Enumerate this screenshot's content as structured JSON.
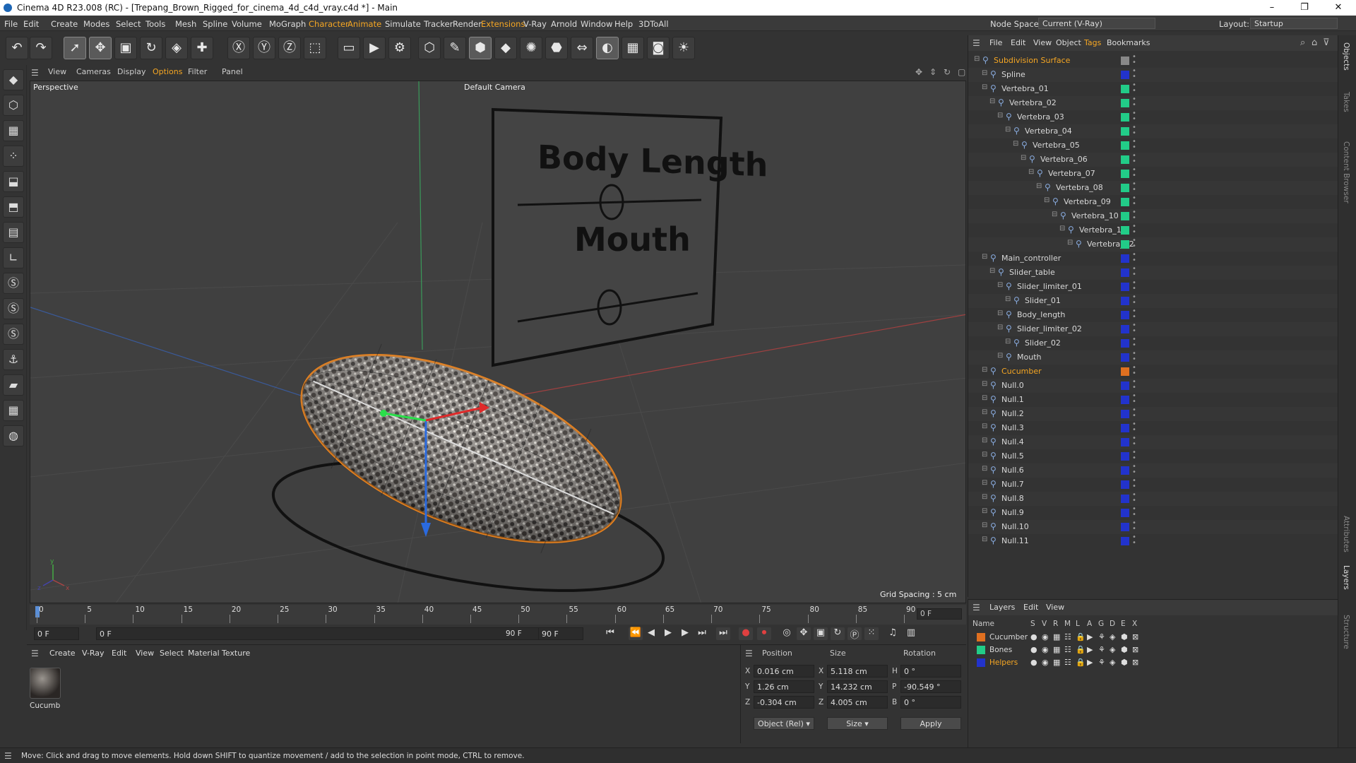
{
  "titlebar": {
    "title": "Cinema 4D R23.008 (RC) - [Trepang_Brown_Rigged_for_cinema_4d_c4d_vray.c4d *] - Main",
    "minimize": "–",
    "maximize": "❐",
    "close": "✕"
  },
  "menu": [
    "File",
    "Edit",
    "Create",
    "Modes",
    "Select",
    "Tools",
    "Mesh",
    "Spline",
    "Volume",
    "MoGraph",
    "Character",
    "Animate",
    "Simulate",
    "Tracker",
    "Render",
    "Extensions",
    "V-Ray",
    "Arnold",
    "Window",
    "Help",
    "3DToAll"
  ],
  "nodespace": {
    "label": "Node Space:",
    "value": "Current (V-Ray)"
  },
  "layout": {
    "label": "Layout:",
    "value": "Startup"
  },
  "viewport": {
    "menu": [
      "View",
      "Cameras",
      "Display",
      "Options",
      "Filter",
      "Panel"
    ],
    "name": "Perspective",
    "camera": "Default Camera",
    "grid_spacing": "Grid Spacing : 5 cm",
    "sign_text_1": "Body Length",
    "sign_text_2": "Mouth"
  },
  "timeline": {
    "ticks": [
      "0",
      "5",
      "10",
      "15",
      "20",
      "25",
      "30",
      "35",
      "40",
      "45",
      "50",
      "55",
      "60",
      "65",
      "70",
      "75",
      "80",
      "85",
      "90"
    ],
    "current": "0 F"
  },
  "transport": {
    "start": "0 F",
    "field2": "0 F",
    "end": "90 F",
    "end2": "90 F"
  },
  "material": {
    "menu": [
      "Create",
      "V-Ray",
      "Edit",
      "View",
      "Select",
      "Material",
      "Texture"
    ],
    "name": "Cucumb"
  },
  "coords": {
    "headers": [
      "Position",
      "Size",
      "Rotation"
    ],
    "x": {
      "axis": "X",
      "pos": "0.016 cm",
      "size_axis": "X",
      "size": "5.118 cm",
      "rot_axis": "H",
      "rot": "0 °"
    },
    "y": {
      "axis": "Y",
      "pos": "1.26 cm",
      "size_axis": "Y",
      "size": "14.232 cm",
      "rot_axis": "P",
      "rot": "-90.549 °"
    },
    "z": {
      "axis": "Z",
      "pos": "-0.304 cm",
      "size_axis": "Z",
      "size": "4.005 cm",
      "rot_axis": "B",
      "rot": "0 °"
    },
    "mode": "Object (Rel)",
    "size_mode": "Size",
    "apply": "Apply"
  },
  "objects": {
    "menu": [
      "File",
      "Edit",
      "View",
      "Object",
      "Tags",
      "Bookmarks"
    ],
    "items": [
      {
        "name": "Subdivision Surface",
        "indent": 0,
        "color": "#f5a623",
        "swatch": "#888"
      },
      {
        "name": "Spline",
        "indent": 1,
        "color": "#d8d8d8",
        "swatch": "#2233cc"
      },
      {
        "name": "Vertebra_01",
        "indent": 1,
        "color": "#d8d8d8",
        "swatch": "#22cc88"
      },
      {
        "name": "Vertebra_02",
        "indent": 2,
        "color": "#d8d8d8",
        "swatch": "#22cc88"
      },
      {
        "name": "Vertebra_03",
        "indent": 3,
        "color": "#d8d8d8",
        "swatch": "#22cc88"
      },
      {
        "name": "Vertebra_04",
        "indent": 4,
        "color": "#d8d8d8",
        "swatch": "#22cc88"
      },
      {
        "name": "Vertebra_05",
        "indent": 5,
        "color": "#d8d8d8",
        "swatch": "#22cc88"
      },
      {
        "name": "Vertebra_06",
        "indent": 6,
        "color": "#d8d8d8",
        "swatch": "#22cc88"
      },
      {
        "name": "Vertebra_07",
        "indent": 7,
        "color": "#d8d8d8",
        "swatch": "#22cc88"
      },
      {
        "name": "Vertebra_08",
        "indent": 8,
        "color": "#d8d8d8",
        "swatch": "#22cc88"
      },
      {
        "name": "Vertebra_09",
        "indent": 9,
        "color": "#d8d8d8",
        "swatch": "#22cc88"
      },
      {
        "name": "Vertebra_10",
        "indent": 10,
        "color": "#d8d8d8",
        "swatch": "#22cc88"
      },
      {
        "name": "Vertebra_11",
        "indent": 11,
        "color": "#d8d8d8",
        "swatch": "#22cc88"
      },
      {
        "name": "Vertebra_12",
        "indent": 12,
        "color": "#d8d8d8",
        "swatch": "#22cc88"
      },
      {
        "name": "Main_controller",
        "indent": 1,
        "color": "#d8d8d8",
        "swatch": "#2233cc"
      },
      {
        "name": "Slider_table",
        "indent": 2,
        "color": "#d8d8d8",
        "swatch": "#2233cc"
      },
      {
        "name": "Slider_limiter_01",
        "indent": 3,
        "color": "#d8d8d8",
        "swatch": "#2233cc"
      },
      {
        "name": "Slider_01",
        "indent": 4,
        "color": "#d8d8d8",
        "swatch": "#2233cc"
      },
      {
        "name": "Body_length",
        "indent": 3,
        "color": "#d8d8d8",
        "swatch": "#2233cc"
      },
      {
        "name": "Slider_limiter_02",
        "indent": 3,
        "color": "#d8d8d8",
        "swatch": "#2233cc"
      },
      {
        "name": "Slider_02",
        "indent": 4,
        "color": "#d8d8d8",
        "swatch": "#2233cc"
      },
      {
        "name": "Mouth",
        "indent": 3,
        "color": "#d8d8d8",
        "swatch": "#2233cc"
      },
      {
        "name": "Cucumber",
        "indent": 1,
        "color": "#f5a623",
        "swatch": "#e07020"
      },
      {
        "name": "Null.0",
        "indent": 1,
        "color": "#d8d8d8",
        "swatch": "#2233cc"
      },
      {
        "name": "Null.1",
        "indent": 1,
        "color": "#d8d8d8",
        "swatch": "#2233cc"
      },
      {
        "name": "Null.2",
        "indent": 1,
        "color": "#d8d8d8",
        "swatch": "#2233cc"
      },
      {
        "name": "Null.3",
        "indent": 1,
        "color": "#d8d8d8",
        "swatch": "#2233cc"
      },
      {
        "name": "Null.4",
        "indent": 1,
        "color": "#d8d8d8",
        "swatch": "#2233cc"
      },
      {
        "name": "Null.5",
        "indent": 1,
        "color": "#d8d8d8",
        "swatch": "#2233cc"
      },
      {
        "name": "Null.6",
        "indent": 1,
        "color": "#d8d8d8",
        "swatch": "#2233cc"
      },
      {
        "name": "Null.7",
        "indent": 1,
        "color": "#d8d8d8",
        "swatch": "#2233cc"
      },
      {
        "name": "Null.8",
        "indent": 1,
        "color": "#d8d8d8",
        "swatch": "#2233cc"
      },
      {
        "name": "Null.9",
        "indent": 1,
        "color": "#d8d8d8",
        "swatch": "#2233cc"
      },
      {
        "name": "Null.10",
        "indent": 1,
        "color": "#d8d8d8",
        "swatch": "#2233cc"
      },
      {
        "name": "Null.11",
        "indent": 1,
        "color": "#d8d8d8",
        "swatch": "#2233cc"
      }
    ]
  },
  "layers": {
    "menu": [
      "Layers",
      "Edit",
      "View"
    ],
    "header": {
      "name": "Name",
      "cols": [
        "S",
        "V",
        "R",
        "M",
        "L",
        "A",
        "G",
        "D",
        "E",
        "X"
      ]
    },
    "items": [
      {
        "name": "Cucumber",
        "color": "#e07020",
        "text_color": "#d8d8d8"
      },
      {
        "name": "Bones",
        "color": "#22cc88",
        "text_color": "#d8d8d8"
      },
      {
        "name": "Helpers",
        "color": "#2233cc",
        "text_color": "#f5a623"
      }
    ]
  },
  "right_tabs": [
    "Objects",
    "Takes",
    "Content Browser",
    "Attributes",
    "Layers",
    "Structure"
  ],
  "status": "Move: Click and drag to move elements. Hold down SHIFT to quantize movement / add to the selection in point mode, CTRL to remove."
}
